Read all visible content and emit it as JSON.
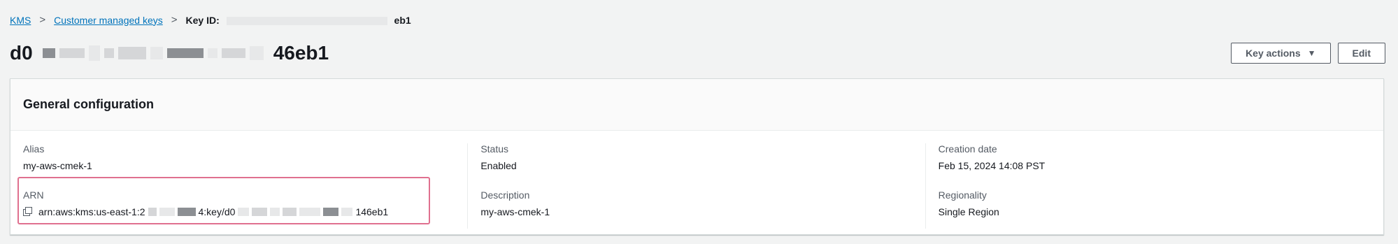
{
  "breadcrumb": {
    "items": [
      {
        "label": "KMS"
      },
      {
        "label": "Customer managed keys"
      }
    ],
    "current_prefix": "Key ID:",
    "current_suffix": "eb1"
  },
  "header": {
    "title_prefix": "d0",
    "title_suffix": "46eb1",
    "key_actions_label": "Key actions",
    "edit_label": "Edit"
  },
  "panel": {
    "title": "General configuration",
    "columns": [
      {
        "fields": [
          {
            "label": "Alias",
            "value": "my-aws-cmek-1"
          },
          {
            "label": "ARN",
            "value_prefix": "arn:aws:kms:us-east-1:2",
            "value_mid": "4:key/d0",
            "value_suffix": "146eb1"
          }
        ]
      },
      {
        "fields": [
          {
            "label": "Status",
            "value": "Enabled"
          },
          {
            "label": "Description",
            "value": "my-aws-cmek-1"
          }
        ]
      },
      {
        "fields": [
          {
            "label": "Creation date",
            "value": "Feb 15, 2024 14:08 PST"
          },
          {
            "label": "Regionality",
            "value": "Single Region"
          }
        ]
      }
    ]
  },
  "icons": {
    "separator": "chevron-right-icon",
    "dropdown": "caret-down-icon",
    "copy": "copy-icon"
  },
  "colors": {
    "link": "#0073bb",
    "highlight_border": "#e0708f"
  }
}
